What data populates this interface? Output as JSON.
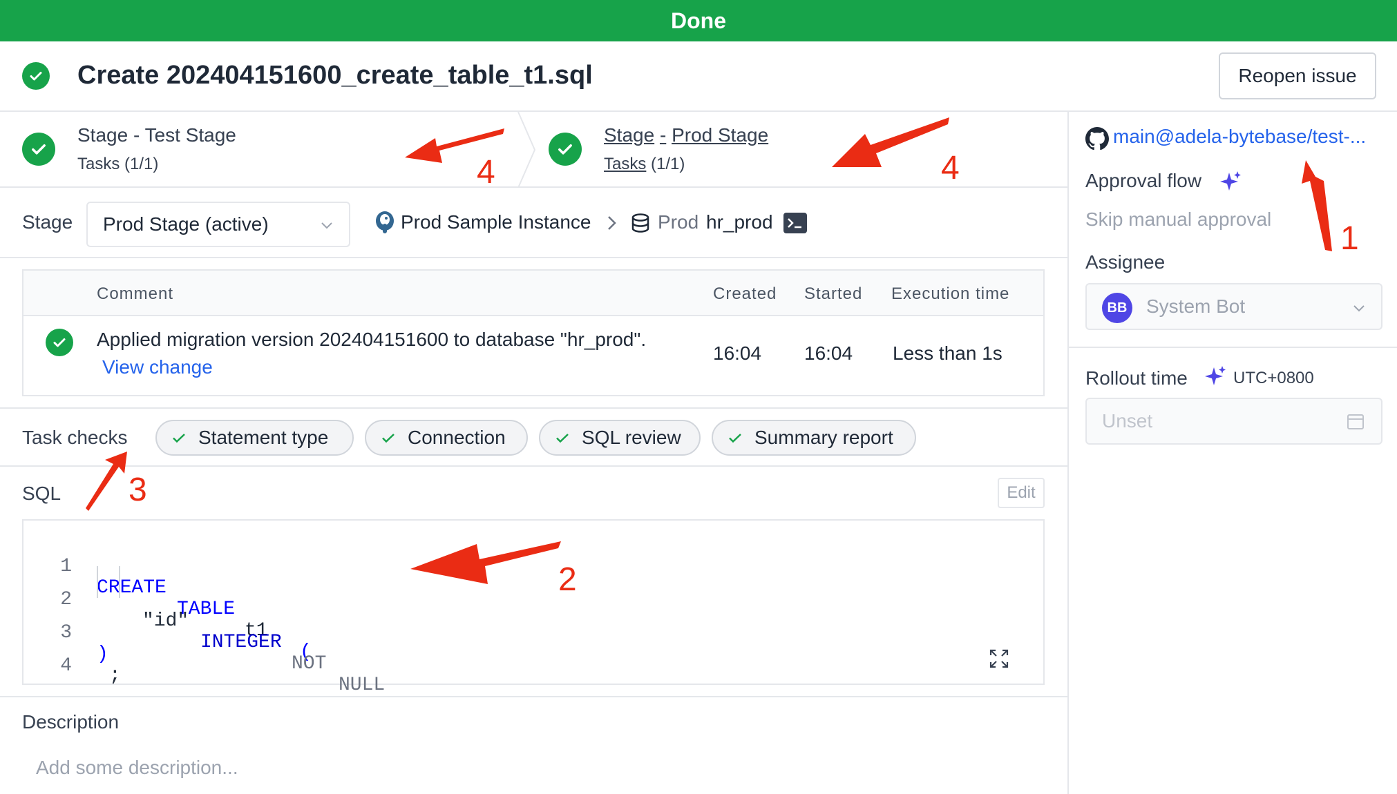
{
  "banner": {
    "status": "Done"
  },
  "header": {
    "title": "Create 202404151600_create_table_t1.sql",
    "reopen_label": "Reopen issue"
  },
  "stages": [
    {
      "prefix": "Stage",
      "sep": "-",
      "name": "Test Stage",
      "tasks_label": "Tasks",
      "tasks_count": "(1/1)"
    },
    {
      "prefix": "Stage",
      "sep": "-",
      "name": "Prod Stage",
      "tasks_label": "Tasks",
      "tasks_count": "(1/1)"
    }
  ],
  "stage_selector": {
    "label": "Stage",
    "selected": "Prod Stage (active)",
    "instance": "Prod Sample Instance",
    "env": "Prod",
    "database": "hr_prod"
  },
  "task_table": {
    "headers": {
      "comment": "Comment",
      "created": "Created",
      "started": "Started",
      "execution": "Execution time"
    },
    "row": {
      "comment": "Applied migration version 202404151600 to database \"hr_prod\".",
      "link": "View change",
      "created": "16:04",
      "started": "16:04",
      "execution": "Less than 1s"
    }
  },
  "task_checks": {
    "label": "Task checks",
    "items": [
      "Statement type",
      "Connection",
      "SQL review",
      "Summary report"
    ]
  },
  "sql": {
    "label": "SQL",
    "edit_label": "Edit",
    "lines": [
      {
        "n": "1",
        "t1": "CREATE",
        "t2": "TABLE",
        "t3": "t1",
        "t4": "("
      },
      {
        "n": "2",
        "t1": "\"id\"",
        "t2": "INTEGER",
        "t3": "NOT",
        "t4": "NULL"
      },
      {
        "n": "3",
        "t1": ")",
        "t2": ";"
      },
      {
        "n": "4"
      }
    ]
  },
  "description": {
    "label": "Description",
    "placeholder": "Add some description..."
  },
  "sidebar": {
    "branch": "main@adela-bytebase/test-...",
    "approval_label": "Approval flow",
    "approval_value": "Skip manual approval",
    "assignee_label": "Assignee",
    "assignee_initials": "BB",
    "assignee_name": "System Bot",
    "rollout_label": "Rollout time",
    "rollout_tz": "UTC+0800",
    "rollout_placeholder": "Unset"
  },
  "annotations": {
    "a1": "1",
    "a2": "2",
    "a3": "3",
    "a4a": "4",
    "a4b": "4"
  },
  "colors": {
    "success": "#17a34a",
    "link": "#2563eb",
    "annotation": "#ea2c14",
    "sparkle": "#4f46e5"
  }
}
